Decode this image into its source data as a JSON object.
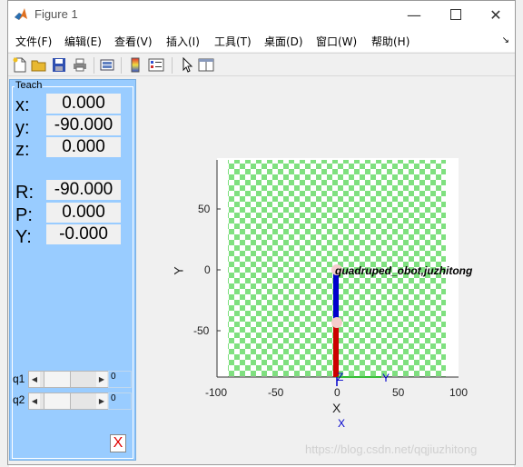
{
  "window": {
    "title": "Figure 1"
  },
  "menu": [
    "文件(F)",
    "编辑(E)",
    "查看(V)",
    "插入(I)",
    "工具(T)",
    "桌面(D)",
    "窗口(W)",
    "帮助(H)"
  ],
  "panel": {
    "title": "Teach",
    "x": {
      "label": "x:",
      "value": "0.000"
    },
    "y": {
      "label": "y:",
      "value": "-90.000"
    },
    "z": {
      "label": "z:",
      "value": "0.000"
    },
    "R": {
      "label": "R:",
      "value": "-90.000"
    },
    "P": {
      "label": "P:",
      "value": "0.000"
    },
    "Y": {
      "label": "Y:",
      "value": "-0.000"
    },
    "q1": {
      "label": "q1",
      "value": "0"
    },
    "q2": {
      "label": "q2",
      "value": "0"
    },
    "close": "X"
  },
  "plot": {
    "xticks": [
      "-100",
      "-50",
      "0",
      "50",
      "100"
    ],
    "yticks": [
      "50",
      "0",
      "-50"
    ],
    "xlabel": "X",
    "ylabel": "Y",
    "robot_name": "quadruped_obot,juzhitong",
    "axis_x_letter": "X",
    "axis_y_letter": "Y",
    "axis_z_letter": "Z",
    "colors": {
      "checker_green": "#7fe07f",
      "link_upper": "#0000cc",
      "link_lower": "#cc0000",
      "joint": "#f4cccc"
    }
  },
  "watermark": "https://blog.csdn.net/qqjiuzhitong"
}
